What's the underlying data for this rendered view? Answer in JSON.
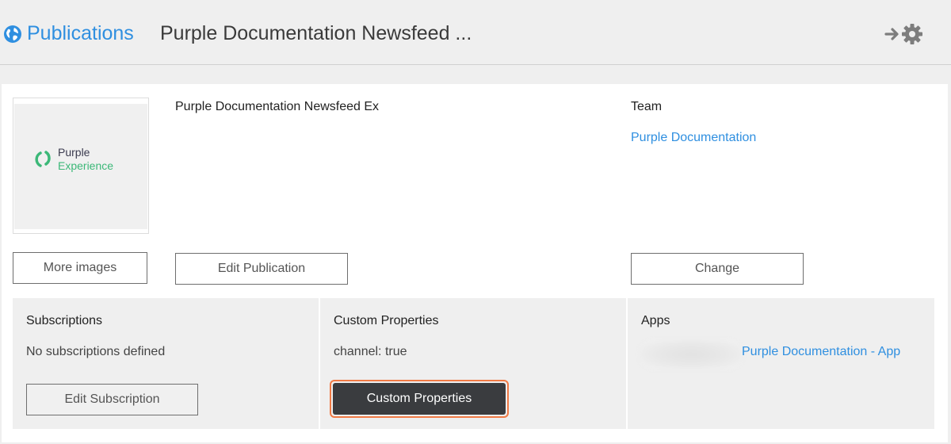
{
  "header": {
    "breadcrumb_link": "Publications",
    "title": "Purple Documentation Newsfeed ...",
    "icons": {
      "globe": "globe-icon",
      "settings": "arrow-gear-icon"
    }
  },
  "publication": {
    "name": "Purple Documentation Newsfeed Ex",
    "cover_logo": {
      "line1": "Purple",
      "line2": "Experience"
    },
    "more_images_label": "More images",
    "edit_label": "Edit Publication"
  },
  "team": {
    "label": "Team",
    "value": "Purple Documentation",
    "change_label": "Change"
  },
  "subscriptions": {
    "title": "Subscriptions",
    "text": "No subscriptions defined",
    "button_label": "Edit Subscription"
  },
  "custom_properties": {
    "title": "Custom Properties",
    "text": "channel: true",
    "button_label": "Custom Properties"
  },
  "apps": {
    "title": "Apps",
    "app_link": "Purple Documentation - App"
  },
  "colors": {
    "link": "#2f8fe0",
    "highlight": "#f07a45",
    "dark_button": "#3a3c3f",
    "logo_green": "#3cb878"
  }
}
